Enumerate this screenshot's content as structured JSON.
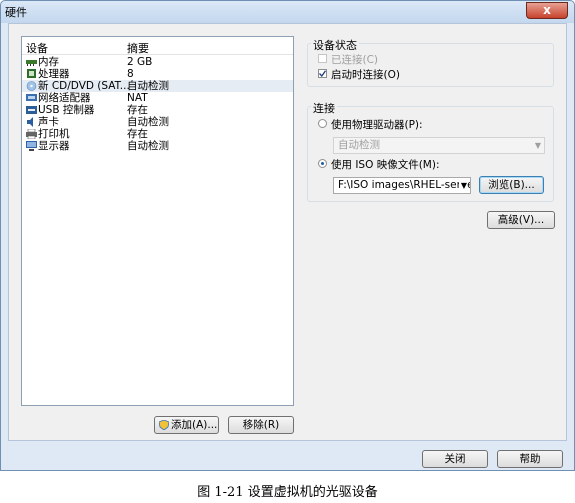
{
  "window": {
    "title": "硬件",
    "close_label": "x"
  },
  "device_list": {
    "col_device": "设备",
    "col_summary": "摘要",
    "items": [
      {
        "name": "内存",
        "summary": "2 GB",
        "icon": "memory-icon"
      },
      {
        "name": "处理器",
        "summary": "8",
        "icon": "processor-icon"
      },
      {
        "name": "新 CD/DVD (SAT...",
        "summary": "自动检测",
        "icon": "cd-dvd-icon",
        "selected": true
      },
      {
        "name": "网络适配器",
        "summary": "NAT",
        "icon": "network-adapter-icon"
      },
      {
        "name": "USB 控制器",
        "summary": "存在",
        "icon": "usb-icon"
      },
      {
        "name": "声卡",
        "summary": "自动检测",
        "icon": "sound-icon"
      },
      {
        "name": "打印机",
        "summary": "存在",
        "icon": "printer-icon"
      },
      {
        "name": "显示器",
        "summary": "自动检测",
        "icon": "display-icon"
      }
    ],
    "add_label": "添加(A)...",
    "remove_label": "移除(R)"
  },
  "device_status": {
    "title": "设备状态",
    "connected_label": "已连接(C)",
    "connected": false,
    "connect_at_power_on_label": "启动时连接(O)",
    "connect_at_power_on": true
  },
  "connection": {
    "title": "连接",
    "physical_label": "使用物理驱动器(P):",
    "physical_value": "自动检测",
    "iso_label": "使用 ISO 映像文件(M):",
    "iso_value": "F:\\ISO images\\RHEL-server-",
    "browse_label": "浏览(B)...",
    "selected": "iso"
  },
  "advanced_label": "高级(V)...",
  "footer": {
    "close_label": "关闭",
    "help_label": "帮助"
  },
  "caption": "图 1-21   设置虚拟机的光驱设备"
}
